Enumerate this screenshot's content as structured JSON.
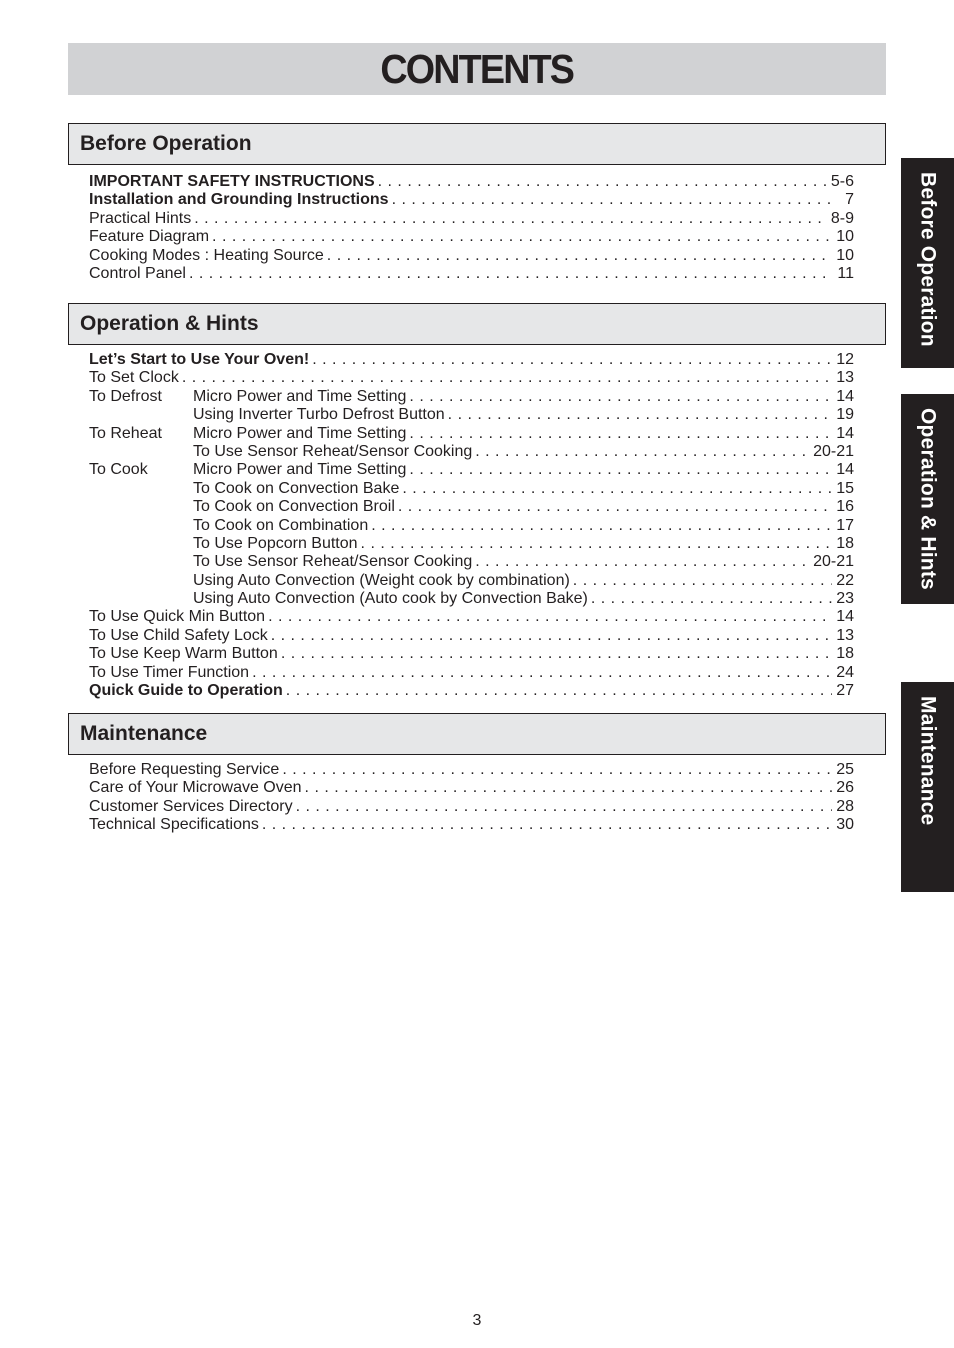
{
  "title": "CONTENTS",
  "sections": [
    {
      "heading": "Before Operation",
      "entries": [
        {
          "category": "",
          "label": "IMPORTANT SAFETY INSTRUCTIONS",
          "page": "5-6",
          "bold": true
        },
        {
          "category": "",
          "label": "Installation and Grounding Instructions",
          "page": "7",
          "bold": true
        },
        {
          "category": "",
          "label": "Practical Hints",
          "page": "8-9",
          "bold": false
        },
        {
          "category": "",
          "label": "Feature Diagram",
          "page": "10",
          "bold": false
        },
        {
          "category": "",
          "label": "Cooking Modes : Heating Source",
          "page": "10",
          "bold": false
        },
        {
          "category": "",
          "label": "Control Panel",
          "page": "11",
          "bold": false
        }
      ]
    },
    {
      "heading": "Operation & Hints",
      "entries": [
        {
          "category": "",
          "label": "Let’s Start to Use Your Oven!",
          "page": "12",
          "bold": true
        },
        {
          "category": "",
          "label": "To Set Clock",
          "page": "13",
          "bold": false
        },
        {
          "category": "To Defrost",
          "label": "Micro Power and Time Setting",
          "page": "14",
          "bold": false
        },
        {
          "category": "",
          "label": "Using Inverter Turbo Defrost Button",
          "page": "19",
          "bold": false,
          "indent": true
        },
        {
          "category": "To Reheat",
          "label": "Micro Power and Time Setting",
          "page": "14",
          "bold": false
        },
        {
          "category": "",
          "label": "To Use Sensor Reheat/Sensor Cooking",
          "page": "20-21",
          "bold": false,
          "indent": true
        },
        {
          "category": "To Cook",
          "label": "Micro Power and Time Setting",
          "page": "14",
          "bold": false
        },
        {
          "category": "",
          "label": "To Cook on Convection Bake",
          "page": "15",
          "bold": false,
          "indent": true
        },
        {
          "category": "",
          "label": "To Cook on Convection Broil",
          "page": "16",
          "bold": false,
          "indent": true
        },
        {
          "category": "",
          "label": "To Cook on Combination",
          "page": "17",
          "bold": false,
          "indent": true
        },
        {
          "category": "",
          "label": "To Use Popcorn Button",
          "page": "18",
          "bold": false,
          "indent": true
        },
        {
          "category": "",
          "label": "To Use Sensor Reheat/Sensor Cooking",
          "page": "20-21",
          "bold": false,
          "indent": true
        },
        {
          "category": "",
          "label": "Using Auto Convection (Weight cook by combination)",
          "page": "22",
          "bold": false,
          "indent": true
        },
        {
          "category": "",
          "label": "Using Auto Convection (Auto cook by Convection Bake)",
          "page": "23",
          "bold": false,
          "indent": true
        },
        {
          "category": "",
          "label": "To Use Quick Min Button",
          "page": "14",
          "bold": false
        },
        {
          "category": "",
          "label": "To Use Child Safety Lock",
          "page": "13",
          "bold": false
        },
        {
          "category": "",
          "label": "To Use Keep Warm Button",
          "page": "18",
          "bold": false
        },
        {
          "category": "",
          "label": "To Use Timer Function",
          "page": "24",
          "bold": false
        },
        {
          "category": "",
          "label": "Quick Guide to Operation",
          "page": "27",
          "bold": true
        }
      ]
    },
    {
      "heading": "Maintenance",
      "entries": [
        {
          "category": "",
          "label": "Before Requesting Service",
          "page": "25",
          "bold": false
        },
        {
          "category": "",
          "label": "Care of Your Microwave Oven",
          "page": "26",
          "bold": false
        },
        {
          "category": "",
          "label": "Customer Services Directory",
          "page": "28",
          "bold": false
        },
        {
          "category": "",
          "label": "Technical Specifications",
          "page": "30",
          "bold": false
        }
      ]
    }
  ],
  "side_tabs": [
    "Before Operation",
    "Operation & Hints",
    "Maintenance"
  ],
  "page_number": "3",
  "colors": {
    "title_bar": "#d1d2d4",
    "section_header": "#e6e7e8",
    "tab": "#231f20",
    "text": "#231f20"
  }
}
